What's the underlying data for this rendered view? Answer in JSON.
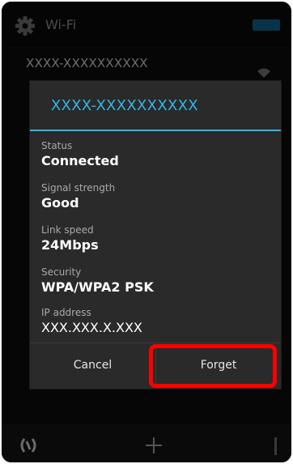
{
  "topbar": {
    "title": "Wi-Fi"
  },
  "network": {
    "name": "XXXX-XXXXXXXXXX"
  },
  "dialog": {
    "title": "XXXX-XXXXXXXXXX",
    "fields": [
      {
        "label": "Status",
        "value": "Connected"
      },
      {
        "label": "Signal strength",
        "value": "Good"
      },
      {
        "label": "Link speed",
        "value": "24Mbps"
      },
      {
        "label": "Security",
        "value": "WPA/WPA2 PSK"
      },
      {
        "label": "IP address",
        "value": "XXX.XXX.X.XXX"
      }
    ],
    "buttons": {
      "cancel": "Cancel",
      "forget": "Forget"
    }
  },
  "colors": {
    "accent": "#33b5e5",
    "highlight": "#ff0000",
    "toggle": "#0e5f86"
  },
  "icons": {
    "top_left": "gear-icon",
    "network": "wifi-signal-icon",
    "bottom_left": "wps-icon",
    "bottom_center": "add-network-icon",
    "bottom_right": "overflow-menu-icon"
  }
}
